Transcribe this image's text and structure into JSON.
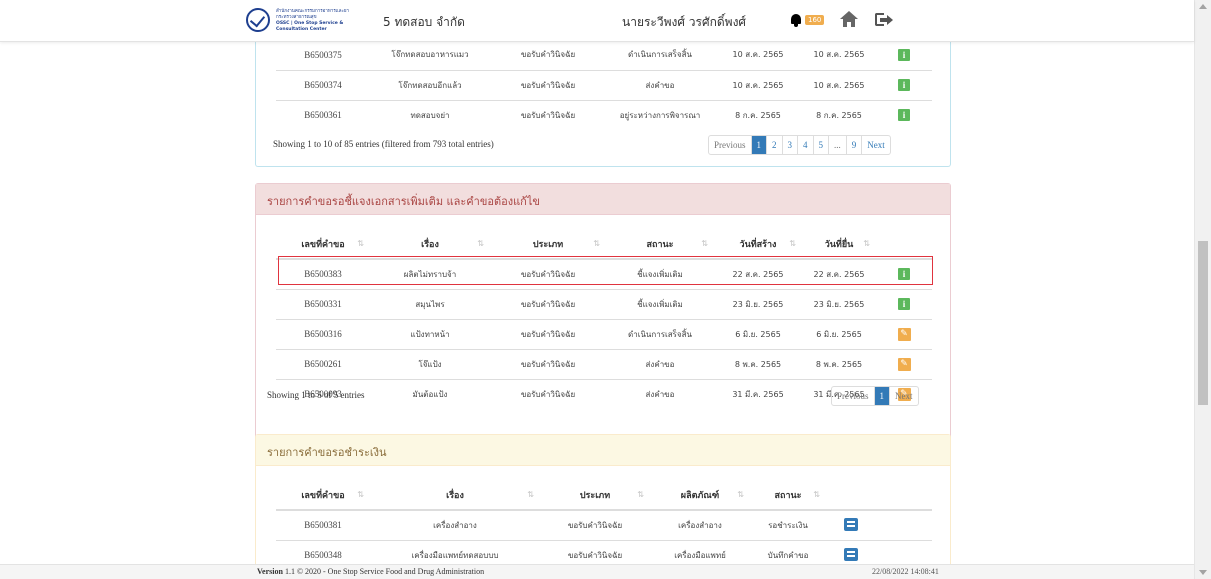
{
  "header": {
    "logo_line1": "สำนักงานคณะกรรมการอาหารและยา",
    "logo_line2": "กระทรวงสาธารณสุข",
    "logo_line3": "OSSC | One Stop Service & Consultation Center",
    "company": "5 ทดสอบ จำกัด",
    "user": "นายระวีพงศ์ วรศักดิ์พงศ์",
    "notif_count": "160"
  },
  "top_table": {
    "rows": [
      {
        "id": "B6500375",
        "subject": "โจ๊กทดสอบอาหารแมว",
        "type": "ขอรับคำวินิจฉัย",
        "status": "ดำเนินการเสร็จสิ้น",
        "created": "10 ส.ค. 2565",
        "submitted": "10 ส.ค. 2565"
      },
      {
        "id": "B6500374",
        "subject": "โจ๊กทดสอบอีกแล้ว",
        "type": "ขอรับคำวินิจฉัย",
        "status": "ส่งคำขอ",
        "created": "10 ส.ค. 2565",
        "submitted": "10 ส.ค. 2565"
      },
      {
        "id": "B6500361",
        "subject": "ทดสอบจย่า",
        "type": "ขอรับคำวินิจฉัย",
        "status": "อยู่ระหว่างการพิจารณา",
        "created": "8 ก.ค. 2565",
        "submitted": "8 ก.ค. 2565"
      }
    ],
    "info": "Showing 1 to 10 of 85 entries (filtered from 793 total entries)",
    "pager": [
      "Previous",
      "1",
      "2",
      "3",
      "4",
      "5",
      "...",
      "9",
      "Next"
    ]
  },
  "clarify_panel": {
    "title": "รายการคำขอรอชี้แจงเอกสารเพิ่มเติม และคำขอต้องแก้ไข",
    "headers": [
      "เลขที่คำขอ",
      "เรื่อง",
      "ประเภท",
      "สถานะ",
      "วันที่สร้าง",
      "วันที่ยื่น"
    ],
    "rows": [
      {
        "id": "B6500383",
        "subject": "ผลิตไม่ทราบจ้า",
        "type": "ขอรับคำวินิจฉัย",
        "status": "ชี้แจงเพิ่มเติม",
        "created": "22 ส.ค. 2565",
        "submitted": "22 ส.ค. 2565",
        "action": "info"
      },
      {
        "id": "B6500331",
        "subject": "สมุนไพร",
        "type": "ขอรับคำวินิจฉัย",
        "status": "ชี้แจงเพิ่มเติม",
        "created": "23 มิ.ย. 2565",
        "submitted": "23 มิ.ย. 2565",
        "action": "info"
      },
      {
        "id": "B6500316",
        "subject": "แป้งทาหน้า",
        "type": "ขอรับคำวินิจฉัย",
        "status": "ดำเนินการเสร็จสิ้น",
        "created": "6 มิ.ย. 2565",
        "submitted": "6 มิ.ย. 2565",
        "action": "edit"
      },
      {
        "id": "B6500261",
        "subject": "โจ๊แป้ง",
        "type": "ขอรับคำวินิจฉัย",
        "status": "ส่งคำขอ",
        "created": "8 พ.ค. 2565",
        "submitted": "8 พ.ค. 2565",
        "action": "edit"
      },
      {
        "id": "B6500093",
        "subject": "มันต้อแป้ง",
        "type": "ขอรับคำวินิจฉัย",
        "status": "ส่งคำขอ",
        "created": "31 มี.ค. 2565",
        "submitted": "31 มี.ค. 2565",
        "action": "edit"
      }
    ],
    "info": "Showing 1 to 5 of 5 entries",
    "pager": [
      "Previous",
      "1",
      "Next"
    ]
  },
  "payment_panel": {
    "title": "รายการคำขอรอชำระเงิน",
    "headers": [
      "เลขที่คำขอ",
      "เรื่อง",
      "ประเภท",
      "ผลิตภัณฑ์",
      "สถานะ"
    ],
    "rows": [
      {
        "id": "B6500381",
        "subject": "เครื่องสำอาง",
        "type": "ขอรับคำวินิจฉัย",
        "product": "เครื่องสำอาง",
        "status": "รอชำระเงิน"
      },
      {
        "id": "B6500348",
        "subject": "เครื่องมือแพทย์ทดสอบบบ",
        "type": "ขอรับคำวินิจฉัย",
        "product": "เครื่องมือแพทย์",
        "status": "บันทึกคำขอ"
      }
    ]
  },
  "footer": {
    "version_label": "Version",
    "version_text": " 1.1 © 2020 - One Stop Service Food and Drug Administration",
    "timestamp": "22/08/2022 14:08:41"
  },
  "colors": {
    "info": "#5cb85c",
    "edit": "#f0ad4e",
    "pay": "#337ab7",
    "highlight": "#e0343f"
  }
}
